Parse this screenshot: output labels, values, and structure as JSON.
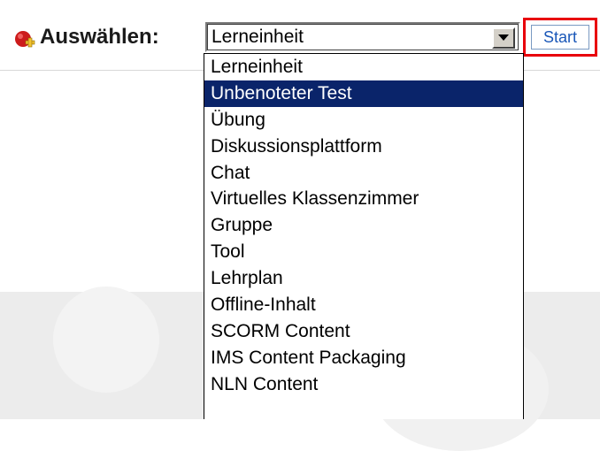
{
  "toolbar": {
    "select_label": "Auswählen:",
    "selected_value": "Lerneinheit",
    "start_label": "Start"
  },
  "dropdown": {
    "options": [
      "Lerneinheit",
      "Unbenoteter Test",
      "Übung",
      "Diskussionsplattform",
      "Chat",
      "Virtuelles Klassenzimmer",
      "Gruppe",
      "Tool",
      "Lehrplan",
      "Offline-Inhalt",
      "SCORM Content",
      "IMS Content Packaging",
      "NLN Content"
    ],
    "highlighted_index": 1
  },
  "colors": {
    "highlight": "#0a246a",
    "start_outline": "#e8000b",
    "start_text": "#1a57b8",
    "add_icon_red": "#cc1b1b",
    "add_icon_plus": "#f2c230"
  },
  "icons": {
    "add": "add-object-icon",
    "dropdown_arrow": "chevron-down-icon"
  }
}
